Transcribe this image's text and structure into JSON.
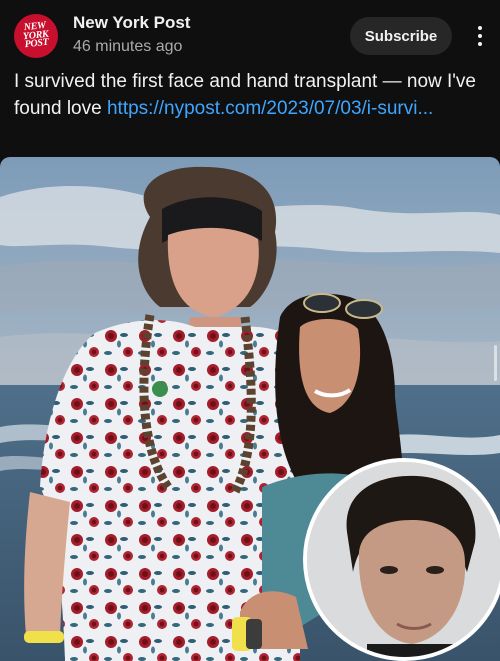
{
  "post": {
    "channel": {
      "name": "New York Post",
      "avatar_text_lines": [
        "NEW",
        "YORK",
        "POST"
      ],
      "avatar_color": "#c8102e"
    },
    "timestamp": "46 minutes ago",
    "subscribe_label": "Subscribe",
    "more_icon": "more-vert-icon",
    "text": "I survived the first face and hand transplant — now I've found love",
    "link_text": "https://nypost.com/2023/07/03/i-survi..."
  },
  "colors": {
    "background": "#0f0f0f",
    "text_primary": "#f1f1f1",
    "text_secondary": "#aaaaaa",
    "link": "#3ea6ff",
    "button_bg": "#272727"
  }
}
